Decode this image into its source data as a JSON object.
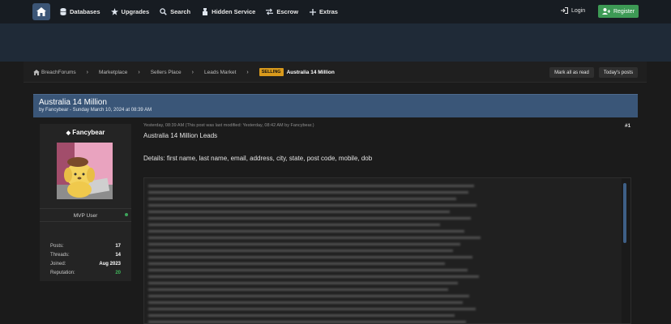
{
  "nav": {
    "items": [
      {
        "label": "Databases",
        "icon": "database-icon"
      },
      {
        "label": "Upgrades",
        "icon": "star-icon"
      },
      {
        "label": "Search",
        "icon": "search-icon"
      },
      {
        "label": "Hidden Service",
        "icon": "tor-icon"
      },
      {
        "label": "Escrow",
        "icon": "exchange-icon"
      },
      {
        "label": "Extras",
        "icon": "plus-icon"
      }
    ],
    "login": "Login",
    "register": "Register"
  },
  "breadcrumb": {
    "items": [
      "BreachForums",
      "Marketplace",
      "Sellers Place",
      "Leads Market"
    ],
    "tag": "SELLING",
    "current": "Australia 14 Million",
    "mark_read": "Mark all as read",
    "todays_posts": "Today's posts"
  },
  "thread": {
    "title": "Australia 14 Million",
    "subtitle": "by Fancybear - Sunday March 10, 2024 at 08:39 AM"
  },
  "user": {
    "name": "Fancybear",
    "role": "MVP User",
    "stats": [
      {
        "label": "Posts:",
        "value": "17"
      },
      {
        "label": "Threads:",
        "value": "14"
      },
      {
        "label": "Joined:",
        "value": "Aug 2023"
      },
      {
        "label": "Reputation:",
        "value": "20"
      }
    ]
  },
  "post": {
    "meta": "Yesterday, 08:39 AM  (This post was last modified: Yesterday, 08:42 AM by Fancybear.)",
    "number": "#1",
    "line1": "Australia 14 Million Leads",
    "line2": "Details: first name, last name, email, address, city, state, post code, mobile, dob"
  },
  "colors": {
    "accent": "#3a5678",
    "register": "#3d9a55",
    "selling": "#d99a1c",
    "reputation": "#3fb75b"
  }
}
